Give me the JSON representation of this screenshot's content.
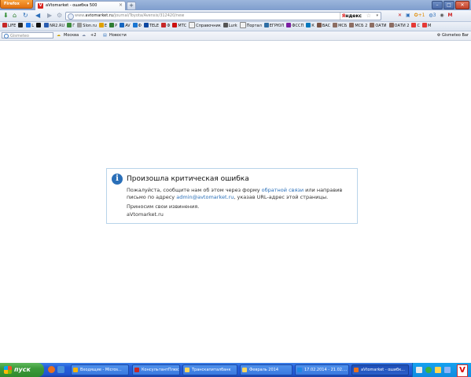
{
  "browser": {
    "app_button": "Firefox",
    "tab_title": "aVtomarket - ошибка 500",
    "tab_favicon": "V",
    "new_tab": "+",
    "url_prefix": "www.",
    "url_host": "avtomarket.ru",
    "url_path": "/journal/Toyota/Avensis/312420/new",
    "search_engine": "Яндекс",
    "nav_right_items": [
      "✕",
      "▣",
      "⚙+1",
      "3",
      "◉",
      "M"
    ]
  },
  "bookmarks": [
    {
      "label": "LIFE",
      "color": "#c62828"
    },
    {
      "label": "",
      "color": "#2b2b2b"
    },
    {
      "label": "L",
      "color": "#1a73e8"
    },
    {
      "label": "",
      "color": "#111111"
    },
    {
      "label": "NR2.RU",
      "color": "#2a5db0"
    },
    {
      "label": "Г",
      "color": "#3d8b3d"
    },
    {
      "label": "Slon.ru",
      "color": "#999999"
    },
    {
      "label": "E",
      "color": "#e0a100"
    },
    {
      "label": "P",
      "color": "#2e7d32"
    },
    {
      "label": "AV",
      "color": "#1565c0"
    },
    {
      "label": "Ф",
      "color": "#1976d2"
    },
    {
      "label": "TELE",
      "color": "#0d47a1"
    },
    {
      "label": "Ф",
      "color": "#c62828"
    },
    {
      "label": "МТС",
      "color": "#cc1010"
    },
    {
      "label": "Справочник",
      "color": "#f2f2f2"
    },
    {
      "label": "Lurk",
      "color": "#555555"
    },
    {
      "label": "Портал",
      "color": "#f2f2f2"
    },
    {
      "label": "ЕГРЮЛ",
      "color": "#2e6da4"
    },
    {
      "label": "ФССП",
      "color": "#7b1fa2"
    },
    {
      "label": "К",
      "color": "#0277bd"
    },
    {
      "label": "ВАС",
      "color": "#795548"
    },
    {
      "label": "МСБ",
      "color": "#8d6e63"
    },
    {
      "label": "МСБ 2",
      "color": "#8d6e63"
    },
    {
      "label": "ОАТИ",
      "color": "#8d6e63"
    },
    {
      "label": "ОАТИ 2",
      "color": "#8d6e63"
    },
    {
      "label": "С",
      "color": "#e53935"
    },
    {
      "label": "М",
      "color": "#e53935"
    }
  ],
  "gismeteo": {
    "search_placeholder": "Gismeteo",
    "city": "Москва",
    "temperature": "+2",
    "news": "Новости",
    "bar_label": "Gismeteo Bar"
  },
  "error": {
    "title": "Произошла критическая ошибка",
    "line1_pre": "Пожалуйста, сообщите нам об этом через форму ",
    "line1_link": "обратной связи",
    "line1_post": " или направив",
    "line2_pre": "письмо по адресу ",
    "line2_link": "admin@avtomarket.ru",
    "line2_post": ", указав URL-адрес этой страницы.",
    "apology": "Приносим свои извинения.",
    "signature": "aVtomarket.ru"
  },
  "taskbar": {
    "start_label": "пуск",
    "buttons": [
      {
        "label": "Входящие - Micros...",
        "color": "#f4b400"
      },
      {
        "label": "КонсультантПлюс: ...",
        "color": "#c62828"
      },
      {
        "label": "Транскапиталбанк",
        "color": "#f9d65c"
      },
      {
        "label": "Февраль 2014",
        "color": "#f9d65c"
      },
      {
        "label": "17.02.2014 - 21.02....",
        "color": "#1e88e5"
      },
      {
        "label": "aVtomarket - ошибк...",
        "color": "#e76f1e"
      }
    ],
    "tray_logo": "V"
  }
}
